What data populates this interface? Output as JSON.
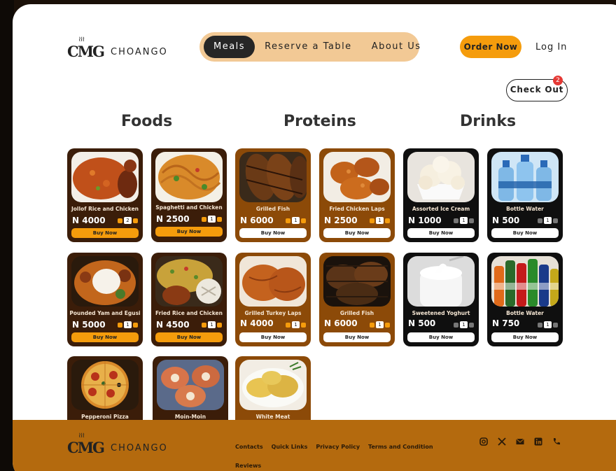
{
  "brand": {
    "mark": "CMG",
    "name": "CHOANGO"
  },
  "nav": {
    "items": [
      "Meals",
      "Reserve a Table",
      "About Us"
    ],
    "active": "Meals"
  },
  "header": {
    "order_label": "Order Now",
    "login_label": "Log In",
    "checkout_label": "Check Out",
    "cart_count": "2"
  },
  "categories": [
    "Foods",
    "Proteins",
    "Drinks"
  ],
  "items": [
    {
      "name": "Jollof Rice and Chicken",
      "price": "N 4000",
      "qty": "2",
      "buy": "Buy Now"
    },
    {
      "name": "Spaghetti and Chicken",
      "price": "N 2500",
      "qty": "1",
      "buy": "Buy Now"
    },
    {
      "name": "Grilled Fish",
      "price": "N 6000",
      "qty": "1",
      "buy": "Buy Now"
    },
    {
      "name": "Fried Chicken Laps",
      "price": "N 2500",
      "qty": "1",
      "buy": "Buy Now"
    },
    {
      "name": "Assorted Ice Cream",
      "price": "N 1000",
      "qty": "1",
      "buy": "Buy Now"
    },
    {
      "name": "Bottle Water",
      "price": "N 500",
      "qty": "1",
      "buy": "Buy Now"
    },
    {
      "name": "Pounded Yam and Egusi",
      "price": "N 5000",
      "qty": "1",
      "buy": "Buy Now"
    },
    {
      "name": "Fried Rice and Chicken",
      "price": "N 4500",
      "qty": "1",
      "buy": "Buy Now"
    },
    {
      "name": "Grilled Turkey Laps",
      "price": "N 4000",
      "qty": "1",
      "buy": "Buy Now"
    },
    {
      "name": "Grilled Fish",
      "price": "N 6000",
      "qty": "1",
      "buy": "Buy Now"
    },
    {
      "name": "Sweetened Yoghurt",
      "price": "N 500",
      "qty": "1",
      "buy": "Buy Now"
    },
    {
      "name": "Bottle Water",
      "price": "N 750",
      "qty": "1",
      "buy": "Buy Now"
    },
    {
      "name": "Pepperoni Pizza"
    },
    {
      "name": "Moin-Moin"
    },
    {
      "name": "White Meat"
    }
  ],
  "footer": {
    "links": [
      "Contacts",
      "Quick Links",
      "Privacy Policy",
      "Terms and Condition",
      "Reviews"
    ],
    "social_icons": [
      "instagram-icon",
      "x-icon",
      "mail-icon",
      "linkedin-icon",
      "phone-icon"
    ]
  },
  "colors": {
    "accent": "#f59c0c",
    "nav_bg": "#f2c995",
    "footer_bg": "#b46a0e",
    "card_dark": "#3b1d09",
    "card_brown": "#8c4a08",
    "badge": "#e53935"
  }
}
